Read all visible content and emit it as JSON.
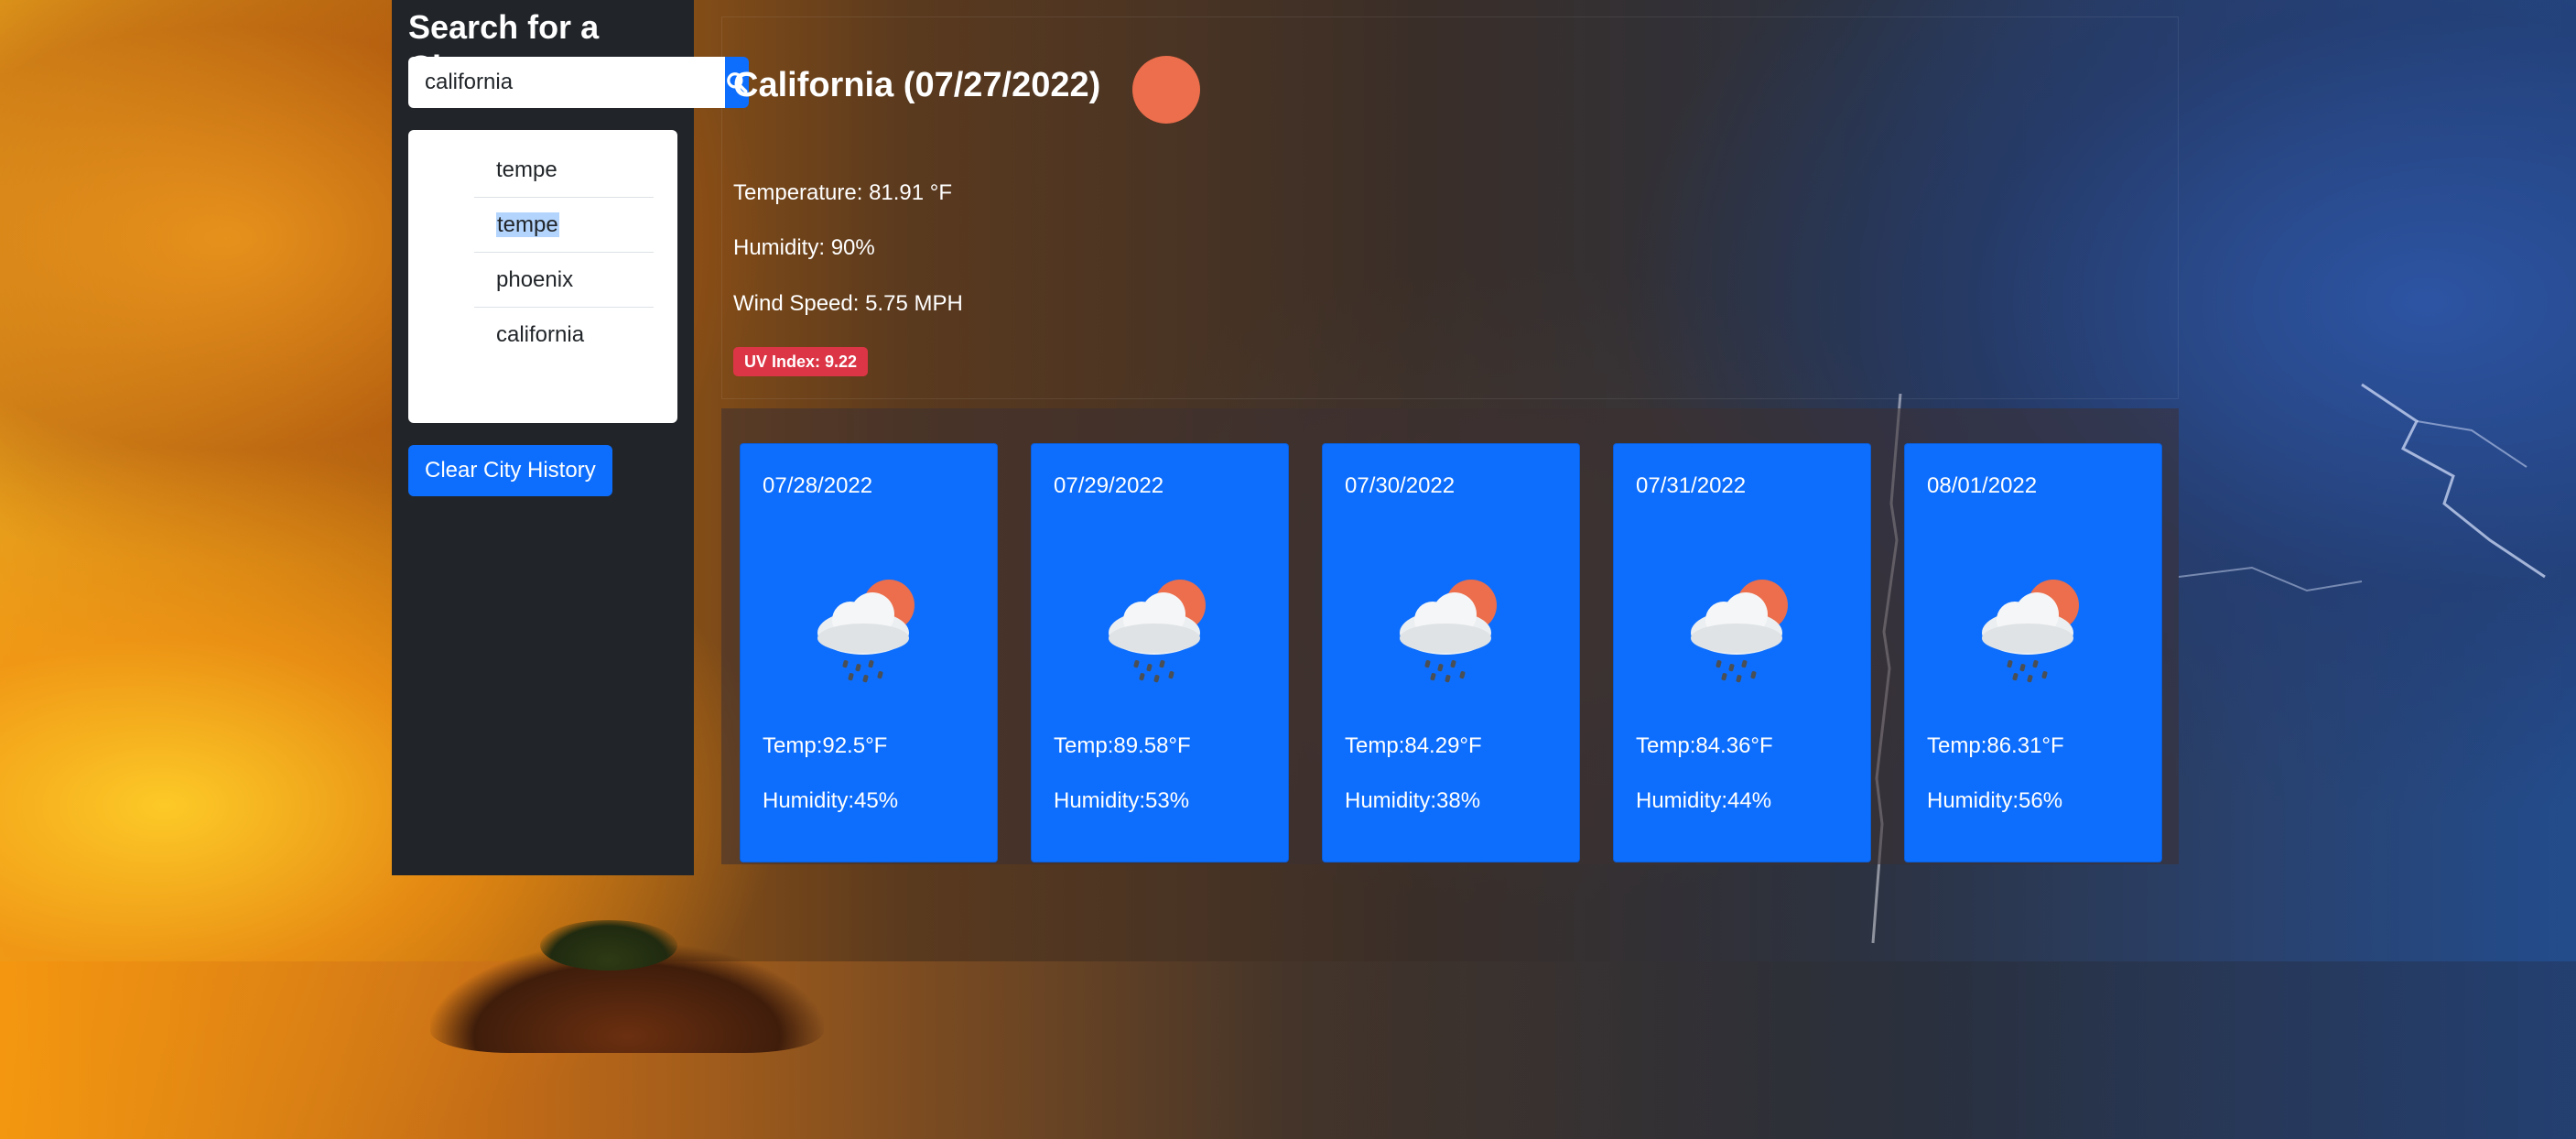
{
  "sidebar": {
    "heading": "Search for a City:",
    "search_value": "california",
    "history": [
      "tempe",
      "tempe",
      "phoenix",
      "california"
    ],
    "clear_label": "Clear City History"
  },
  "current": {
    "title": "California (07/27/2022)",
    "temperature": "Temperature: 81.91 °F",
    "humidity": "Humidity: 90%",
    "wind": "Wind Speed: 5.75 MPH",
    "uv": "UV Index: 9.22",
    "icon": "sun-icon"
  },
  "forecast": [
    {
      "date": "07/28/2022",
      "temp": "Temp:92.5°F",
      "humidity": "Humidity:45%",
      "icon": "cloud-sun-rain-icon"
    },
    {
      "date": "07/29/2022",
      "temp": "Temp:89.58°F",
      "humidity": "Humidity:53%",
      "icon": "cloud-sun-rain-icon"
    },
    {
      "date": "07/30/2022",
      "temp": "Temp:84.29°F",
      "humidity": "Humidity:38%",
      "icon": "cloud-sun-rain-icon"
    },
    {
      "date": "07/31/2022",
      "temp": "Temp:84.36°F",
      "humidity": "Humidity:44%",
      "icon": "cloud-sun-rain-icon"
    },
    {
      "date": "08/01/2022",
      "temp": "Temp:86.31°F",
      "humidity": "Humidity:56%",
      "icon": "cloud-sun-rain-icon"
    }
  ],
  "colors": {
    "primary": "#0d6efd",
    "sidebar_bg": "#212529",
    "uv_badge": "#dc3545",
    "sun": "#ec6e4c"
  }
}
